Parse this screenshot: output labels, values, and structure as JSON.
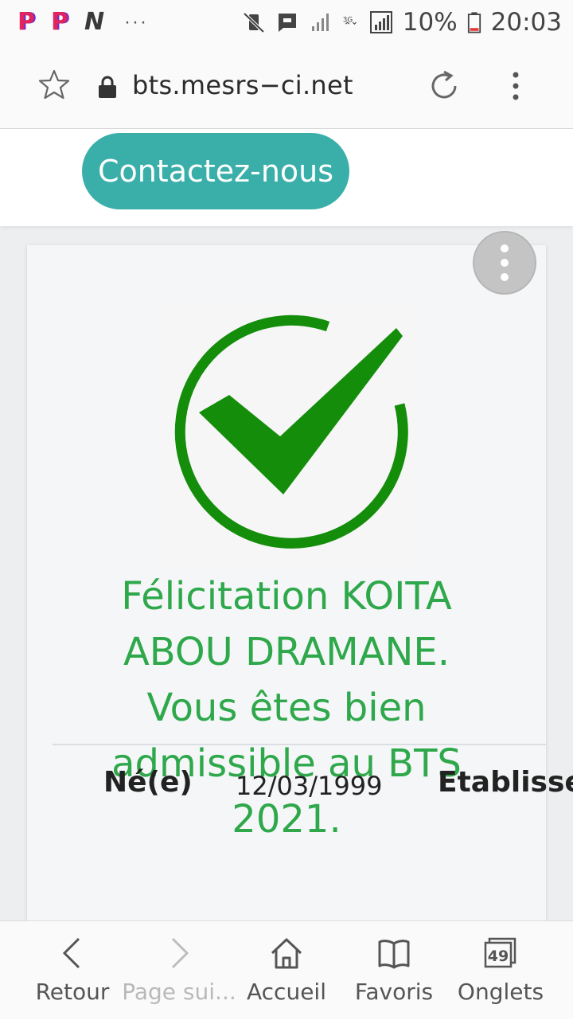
{
  "status_bar": {
    "app_icons": [
      "P",
      "P",
      "N"
    ],
    "more": "···",
    "battery_percent": "10%",
    "time": "20:03",
    "network": "3G"
  },
  "browser": {
    "url": "bts.mesrs−ci.net"
  },
  "page": {
    "contact_button": "Contactez-nous",
    "message": "Félicitation KOITA ABOU DRAMANE. Vous êtes bien admissible au BTS 2021.",
    "born_label": "Né(e)",
    "born_value": "12/03/1999",
    "school_label": "Etablisse"
  },
  "bottom_nav": {
    "back": "Retour",
    "forward": "Page sui...",
    "home": "Accueil",
    "favorites": "Favoris",
    "tabs": "Onglets",
    "tab_count": "49"
  },
  "colors": {
    "accent_teal": "#3aafa9",
    "success_green": "#2ea84a",
    "check_green": "#138d0a"
  }
}
